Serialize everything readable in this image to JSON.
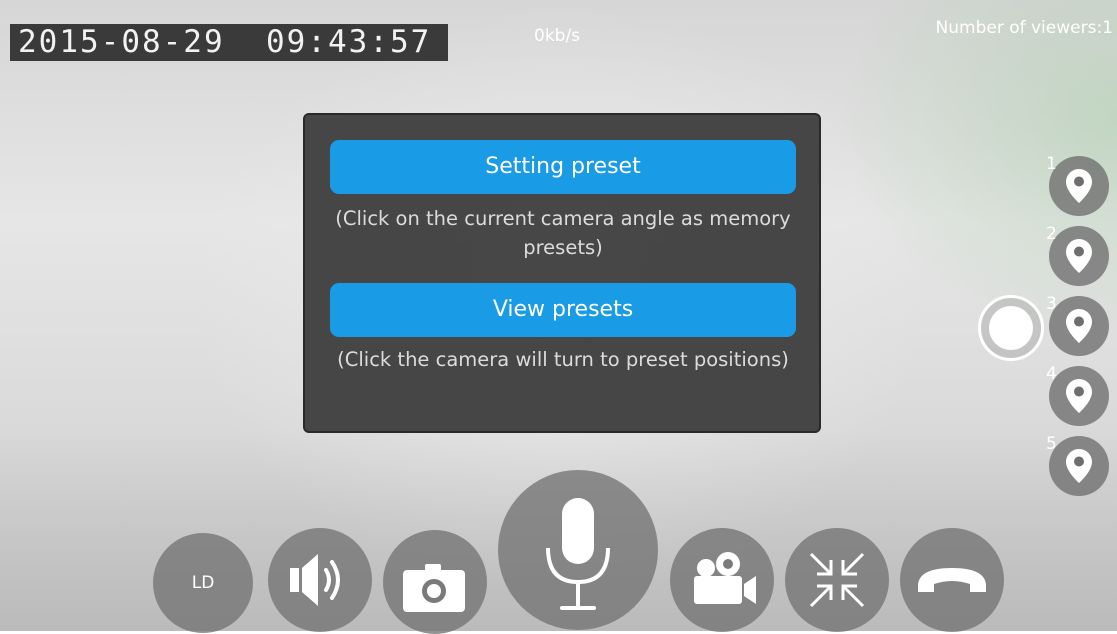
{
  "overlay": {
    "timestamp": "2015-08-29  09:43:57",
    "bitrate": "0kb/s",
    "viewers": "Number of viewers:1"
  },
  "dialog": {
    "setting_preset_label": "Setting preset",
    "setting_preset_desc": "(Click on the current camera angle as memory presets)",
    "view_presets_label": "View presets",
    "view_presets_desc": "(Click the camera will turn to preset positions)",
    "accent_color": "#1a9be6"
  },
  "presets": [
    {
      "number": "1",
      "icon": "location-pin-icon"
    },
    {
      "number": "2",
      "icon": "location-pin-icon"
    },
    {
      "number": "3",
      "icon": "location-pin-icon"
    },
    {
      "number": "4",
      "icon": "location-pin-icon"
    },
    {
      "number": "5",
      "icon": "location-pin-icon"
    }
  ],
  "controls": {
    "quality_label": "LD",
    "items": [
      "quality-button",
      "speaker-icon",
      "camera-icon",
      "microphone-icon",
      "video-record-icon",
      "fullscreen-exit-icon",
      "hang-up-icon"
    ]
  }
}
